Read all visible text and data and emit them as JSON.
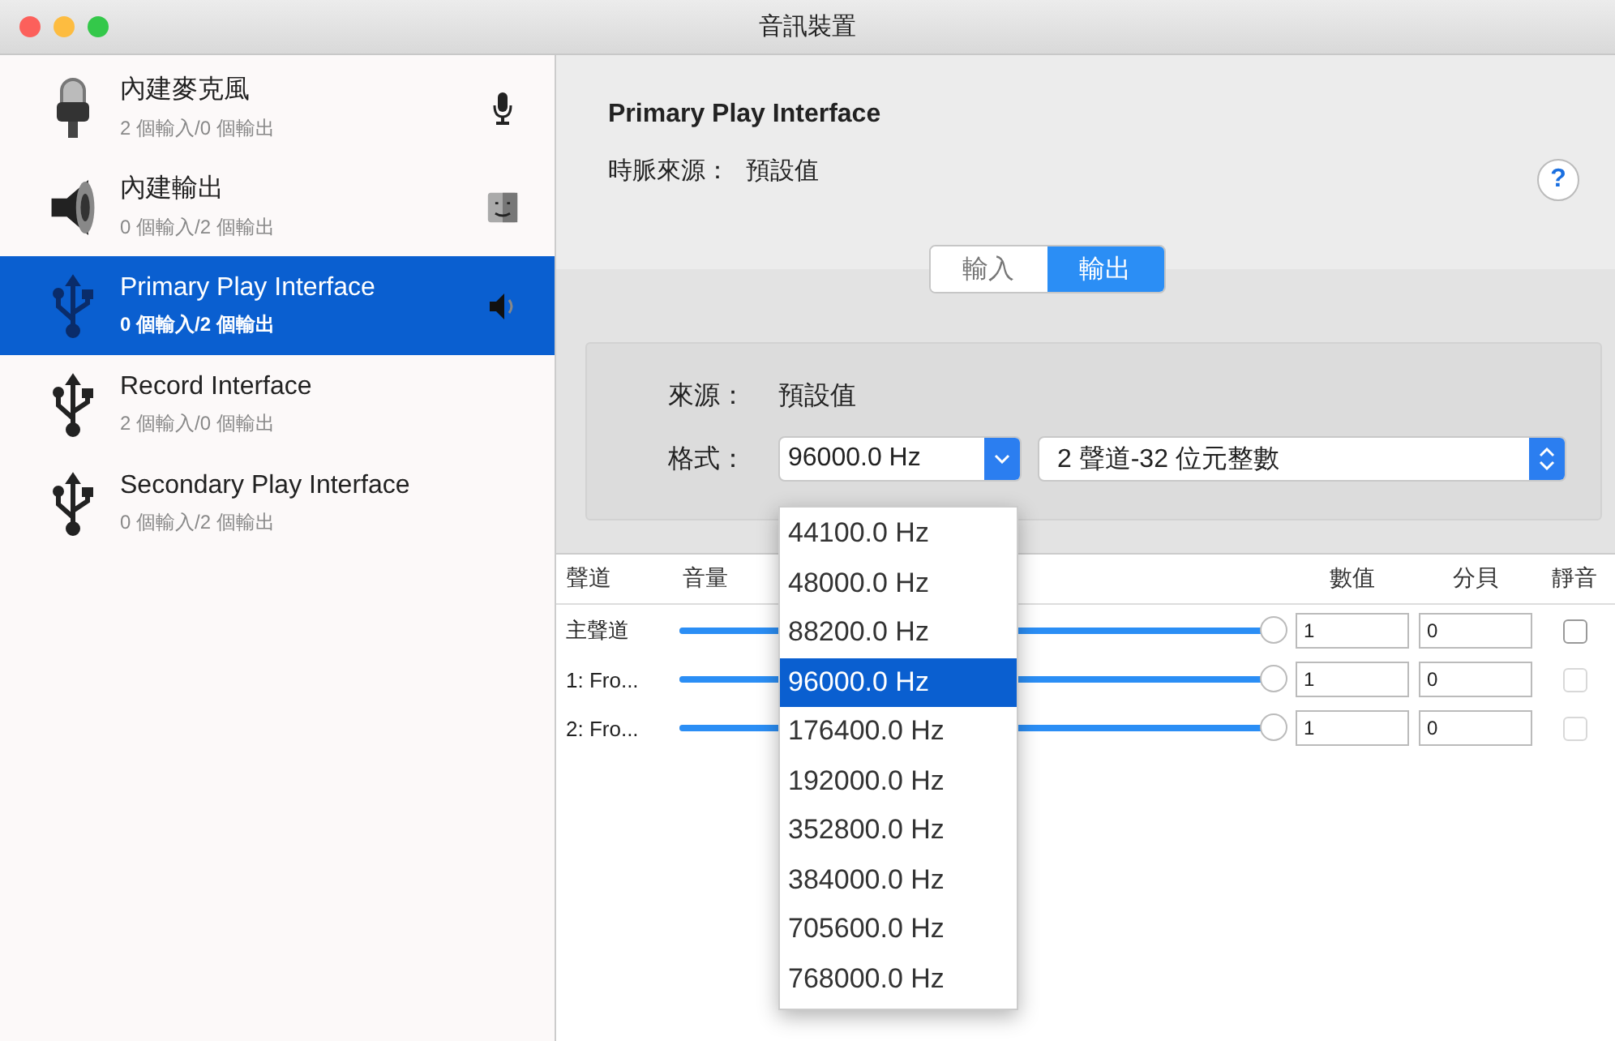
{
  "window": {
    "title": "音訊裝置"
  },
  "devices": [
    {
      "name": "內建麥克風",
      "io": "2 個輸入/0 個輸出",
      "kind": "mic",
      "selected": false
    },
    {
      "name": "內建輸出",
      "io": "0 個輸入/2 個輸出",
      "kind": "speaker",
      "selected": false
    },
    {
      "name": "Primary Play Interface",
      "io": "0 個輸入/2 個輸出",
      "kind": "usb",
      "selected": true
    },
    {
      "name": "Record Interface",
      "io": "2 個輸入/0 個輸出",
      "kind": "usb",
      "selected": false
    },
    {
      "name": "Secondary Play Interface",
      "io": "0 個輸入/2 個輸出",
      "kind": "usb",
      "selected": false
    }
  ],
  "detail": {
    "title": "Primary Play Interface",
    "clock_label": "時脈來源：",
    "clock_value": "預設值",
    "help": "?"
  },
  "tabs": [
    {
      "label": "輸入",
      "selected": false
    },
    {
      "label": "輸出",
      "selected": true
    }
  ],
  "source": {
    "label": "來源：",
    "value": "預設值"
  },
  "format": {
    "label": "格式：",
    "rate": "96000.0 Hz",
    "type": "2 聲道-32 位元整數"
  },
  "rate_menu": [
    {
      "label": "44100.0 Hz",
      "selected": false
    },
    {
      "label": "48000.0 Hz",
      "selected": false
    },
    {
      "label": "88200.0 Hz",
      "selected": false
    },
    {
      "label": "96000.0 Hz",
      "selected": true
    },
    {
      "label": "176400.0 Hz",
      "selected": false
    },
    {
      "label": "192000.0 Hz",
      "selected": false
    },
    {
      "label": "352800.0 Hz",
      "selected": false
    },
    {
      "label": "384000.0 Hz",
      "selected": false
    },
    {
      "label": "705600.0 Hz",
      "selected": false
    },
    {
      "label": "768000.0 Hz",
      "selected": false
    }
  ],
  "table": {
    "columns": [
      "聲道",
      "音量",
      "數值",
      "分貝",
      "靜音"
    ],
    "rows": [
      {
        "channel": "主聲道",
        "level": 1,
        "value": "1",
        "db": "0",
        "muted": false,
        "disabled": false
      },
      {
        "channel": "1: Fro...",
        "level": 1,
        "value": "1",
        "db": "0",
        "muted": false,
        "disabled": true
      },
      {
        "channel": "2: Fro...",
        "level": 1,
        "value": "1",
        "db": "0",
        "muted": false,
        "disabled": true
      }
    ]
  }
}
